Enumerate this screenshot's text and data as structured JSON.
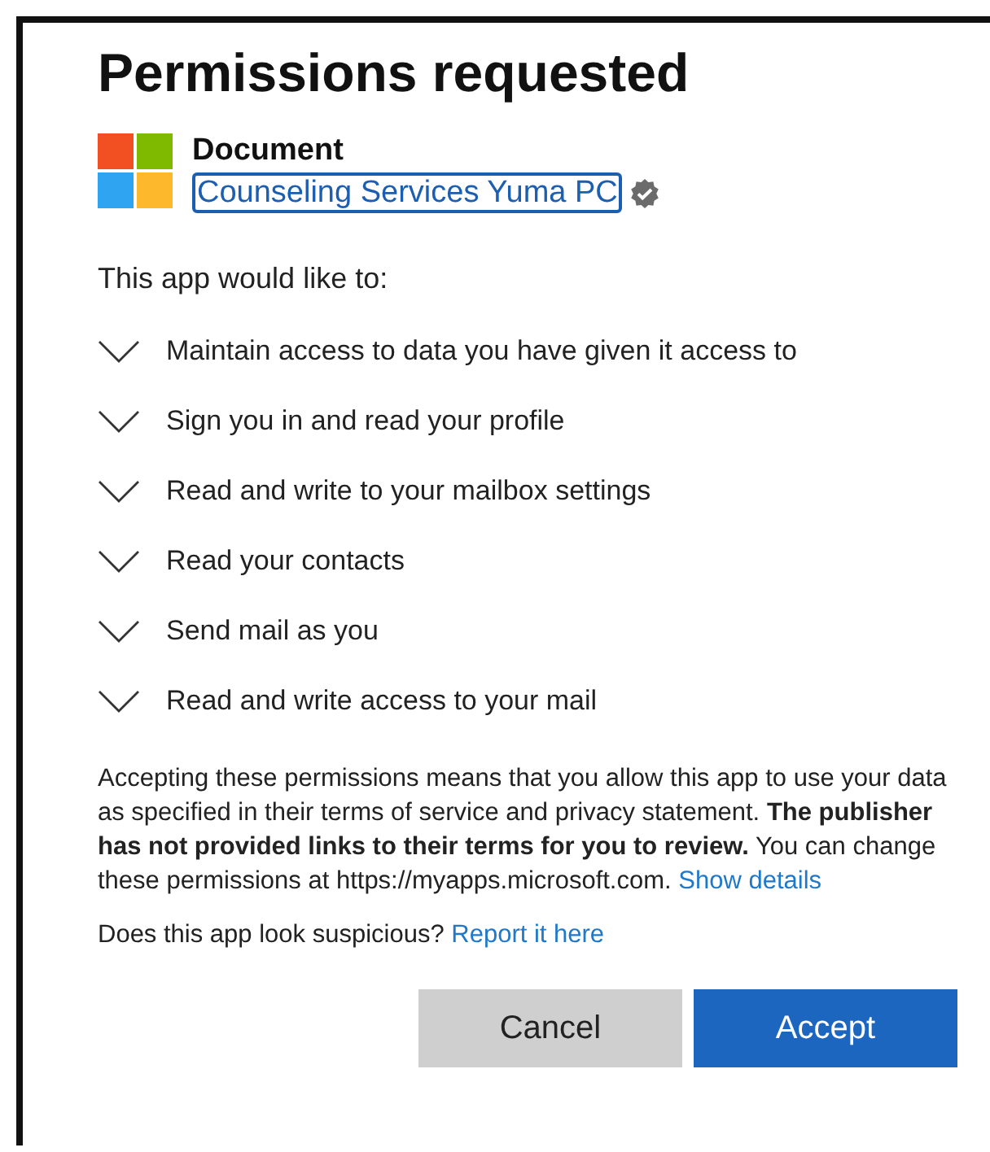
{
  "title": "Permissions requested",
  "app": {
    "name": "Document",
    "publisher": "Counseling Services Yuma PC",
    "publisher_focused": true,
    "verified": true
  },
  "intro": "This app would like to:",
  "permissions": [
    {
      "label": "Maintain access to data you have given it access to",
      "expanded": false
    },
    {
      "label": "Sign you in and read your profile",
      "expanded": false
    },
    {
      "label": "Read and write to your mailbox settings",
      "expanded": false
    },
    {
      "label": "Read your contacts",
      "expanded": false
    },
    {
      "label": "Send mail as you",
      "expanded": false
    },
    {
      "label": "Read and write access to your mail",
      "expanded": false
    }
  ],
  "consent": {
    "text": "Accepting these permissions means that you allow this app to use your data as specified in their terms of service and privacy statement. **The publisher has not provided links to their terms for you to review.** You can change these permissions at https://myapps.microsoft.com.",
    "link": "Show details"
  },
  "suspicious": {
    "text": "Does this app look suspicious?",
    "link": "Report it here"
  },
  "buttons": [
    {
      "label": "Cancel",
      "kind": "secondary"
    },
    {
      "label": "Accept",
      "kind": "primary"
    }
  ]
}
